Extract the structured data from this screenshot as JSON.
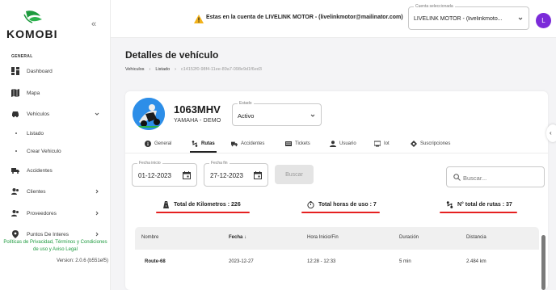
{
  "brand": {
    "name": "KOMOBI",
    "accent": "#1d9a3e"
  },
  "sidebar": {
    "section_label": "GENERAL",
    "items": [
      {
        "label": "Dashboard",
        "icon": "dashboard-icon"
      },
      {
        "label": "Mapa",
        "icon": "map-icon"
      },
      {
        "label": "Vehículos",
        "icon": "car-icon",
        "expanded": true
      },
      {
        "label": "Listado",
        "sub": true
      },
      {
        "label": "Crear Vehiculo",
        "sub": true
      },
      {
        "label": "Accidentes",
        "icon": "truck-icon"
      },
      {
        "label": "Clientes",
        "icon": "people-icon"
      },
      {
        "label": "Proveedores",
        "icon": "people-icon"
      },
      {
        "label": "Puntos De Interes",
        "icon": "location-icon"
      }
    ],
    "policy_line1": "Políticas de Privacidad, Términos y Condiciones",
    "policy_line2": "de uso y Aviso Legal",
    "version": "Version: 2.0.6 (b551ef5)"
  },
  "topbar": {
    "account_text": "Estas en la cuenta de LIVELINK MOTOR - (livelinkmotor@mailinator.com)",
    "account_select_legend": "Cuenta seleccionada",
    "account_select_value": "LIVELINK MOTOR - (livelinkmoto...",
    "avatar_initial": "L",
    "avatar_color": "#7b2bd9"
  },
  "page": {
    "title": "Detalles de vehículo",
    "breadcrumb": [
      "Vehiculos",
      "Listado",
      "c14152f0-98f4-11ee-89a7-098e9d1f6ed3"
    ]
  },
  "vehicle": {
    "plate": "1063MHV",
    "model": "YAMAHA - DEMO",
    "estado_legend": "Estado",
    "estado_value": "Activo"
  },
  "tabs": [
    "General",
    "Rutas",
    "Accidentes",
    "Tickets",
    "Usuario",
    "Iot",
    "Suscripciones"
  ],
  "active_tab": "Rutas",
  "filters": {
    "start_legend": "Fecha inicio",
    "start_value": "01-12-2023",
    "end_legend": "Fecha fin",
    "end_value": "27-12-2023",
    "search_button": "Buscar",
    "search_placeholder": "Buscar..."
  },
  "stats": {
    "km": "Total de Kilometros : 226",
    "hours": "Total horas de uso : 7",
    "routes": "N° total de rutas : 37",
    "underline_color": "#e52020"
  },
  "table": {
    "headers": [
      "Nombre",
      "Fecha",
      "Hora Inicio/Fin",
      "Duración",
      "Distancia"
    ],
    "rows": [
      [
        "Route-68",
        "2023-12-27",
        "12:28 - 12:33",
        "5 min",
        "2.484 km"
      ]
    ]
  }
}
